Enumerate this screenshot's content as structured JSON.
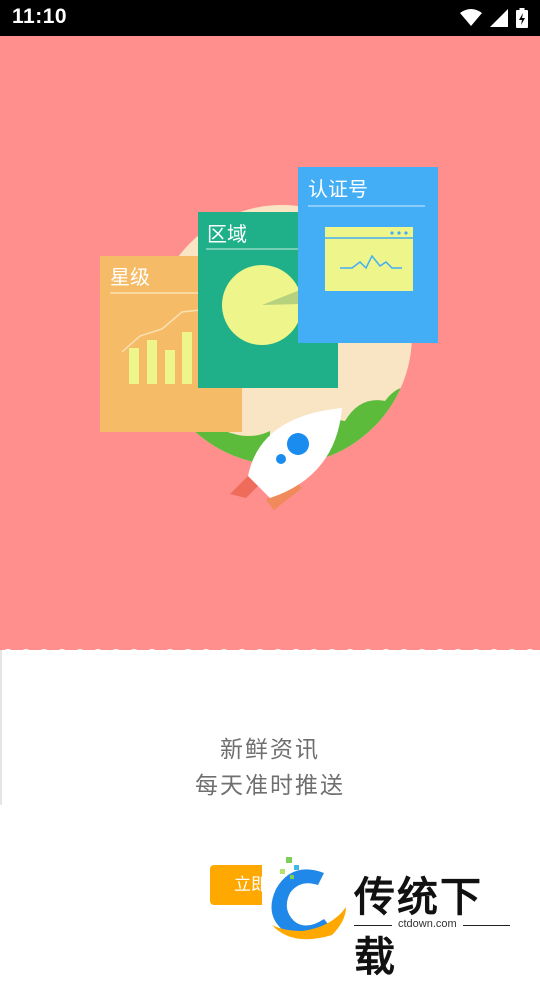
{
  "status_bar": {
    "time": "11:10"
  },
  "illustration": {
    "cards": [
      {
        "label": "星级",
        "color": "#f5bb66"
      },
      {
        "label": "区域",
        "color": "#1fb08a"
      },
      {
        "label": "认证号",
        "color": "#43aef5"
      }
    ]
  },
  "content": {
    "line1": "新鲜资讯",
    "line2": "每天准时推送",
    "start_button": "立即"
  },
  "watermark": {
    "brand": "传统下载",
    "url": "ctdown.com"
  },
  "colors": {
    "hero_bg": "#ff8f8d",
    "button": "#ffa800",
    "accent_blue": "#43aef5",
    "accent_green": "#1fb08a",
    "accent_orange": "#f5bb66"
  }
}
